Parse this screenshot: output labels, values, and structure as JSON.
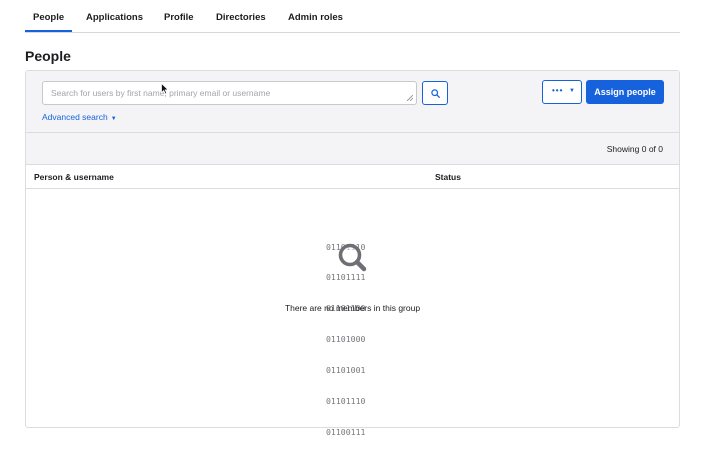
{
  "tabs": [
    {
      "label": "People",
      "active": true
    },
    {
      "label": "Applications",
      "active": false
    },
    {
      "label": "Profile",
      "active": false
    },
    {
      "label": "Directories",
      "active": false
    },
    {
      "label": "Admin roles",
      "active": false
    }
  ],
  "page_title": "People",
  "search": {
    "placeholder": "Search for users by first name, primary email or username",
    "value": "",
    "button_icon": "search-icon"
  },
  "advanced_search_label": "Advanced search",
  "more_actions": {
    "icon": "more-dots-icon",
    "caret": "▼"
  },
  "assign_button_label": "Assign people",
  "showing_text": "Showing 0 of 0",
  "columns": [
    "Person & username",
    "Status"
  ],
  "empty_state": {
    "binary_lines": [
      "01101110",
      "01101111",
      "01101100",
      "01101000",
      "01101001",
      "01101110",
      "01100111"
    ],
    "icon": "magnifier-icon",
    "message": "There are no members in this group"
  },
  "colors": {
    "accent": "#1662dd",
    "toolbar_bg": "#f4f4f6",
    "border": "#dcdce0",
    "text": "#1d1d21"
  }
}
